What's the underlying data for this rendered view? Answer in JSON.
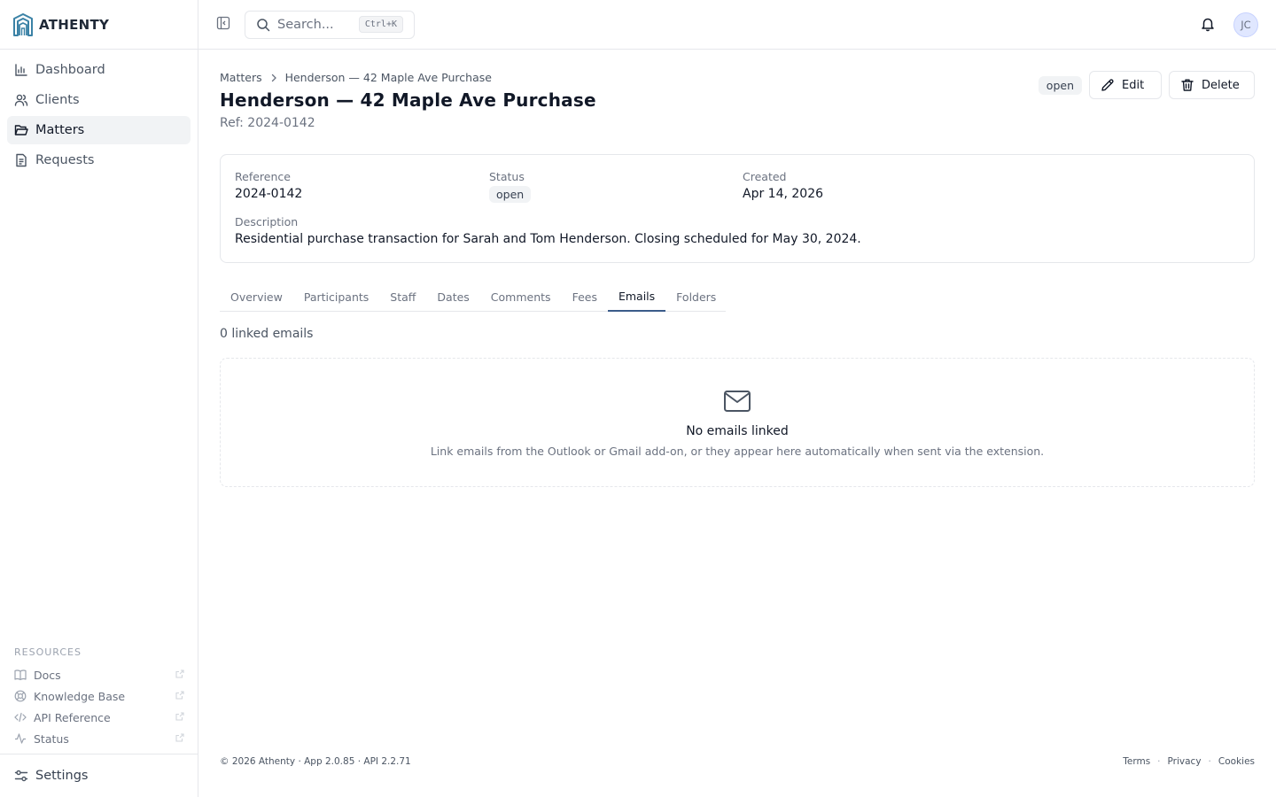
{
  "brand": {
    "name": "ATHENTY",
    "accent": "#3b82a6"
  },
  "sidebar": {
    "items": [
      {
        "label": "Dashboard",
        "icon": "bar-chart-icon",
        "active": false
      },
      {
        "label": "Clients",
        "icon": "users-icon",
        "active": false
      },
      {
        "label": "Matters",
        "icon": "folder-open-icon",
        "active": true
      },
      {
        "label": "Requests",
        "icon": "document-icon",
        "active": false
      }
    ],
    "resources_title": "RESOURCES",
    "resources": [
      {
        "label": "Docs",
        "icon": "book-icon"
      },
      {
        "label": "Knowledge Base",
        "icon": "lifebuoy-icon"
      },
      {
        "label": "API Reference",
        "icon": "code-icon"
      },
      {
        "label": "Status",
        "icon": "activity-icon"
      }
    ],
    "settings_label": "Settings"
  },
  "topbar": {
    "search_placeholder": "Search...",
    "search_shortcut": "Ctrl+K",
    "avatar_initials": "JC"
  },
  "breadcrumb": {
    "parent": "Matters",
    "current": "Henderson — 42 Maple Ave Purchase"
  },
  "page": {
    "title": "Henderson — 42 Maple Ave Purchase",
    "ref": "Ref: 2024-0142",
    "status_badge": "open",
    "edit_label": "Edit",
    "delete_label": "Delete"
  },
  "details": {
    "reference_label": "Reference",
    "reference_value": "2024-0142",
    "status_label": "Status",
    "status_value": "open",
    "created_label": "Created",
    "created_value": "Apr 14, 2026",
    "description_label": "Description",
    "description_value": "Residential purchase transaction for Sarah and Tom Henderson. Closing scheduled for May 30, 2024."
  },
  "tabs": [
    {
      "label": "Overview",
      "active": false
    },
    {
      "label": "Participants",
      "active": false
    },
    {
      "label": "Staff",
      "active": false
    },
    {
      "label": "Dates",
      "active": false
    },
    {
      "label": "Comments",
      "active": false
    },
    {
      "label": "Fees",
      "active": false
    },
    {
      "label": "Emails",
      "active": true
    },
    {
      "label": "Folders",
      "active": false
    }
  ],
  "emails": {
    "count_text": "0 linked emails",
    "empty_title": "No emails linked",
    "empty_desc": "Link emails from the Outlook or Gmail add-on, or they appear here automatically when sent via the extension."
  },
  "footer": {
    "left": "© 2026 Athenty · App 2.0.85 · API 2.2.71",
    "links": [
      "Terms",
      "Privacy",
      "Cookies"
    ],
    "separator": "·"
  }
}
